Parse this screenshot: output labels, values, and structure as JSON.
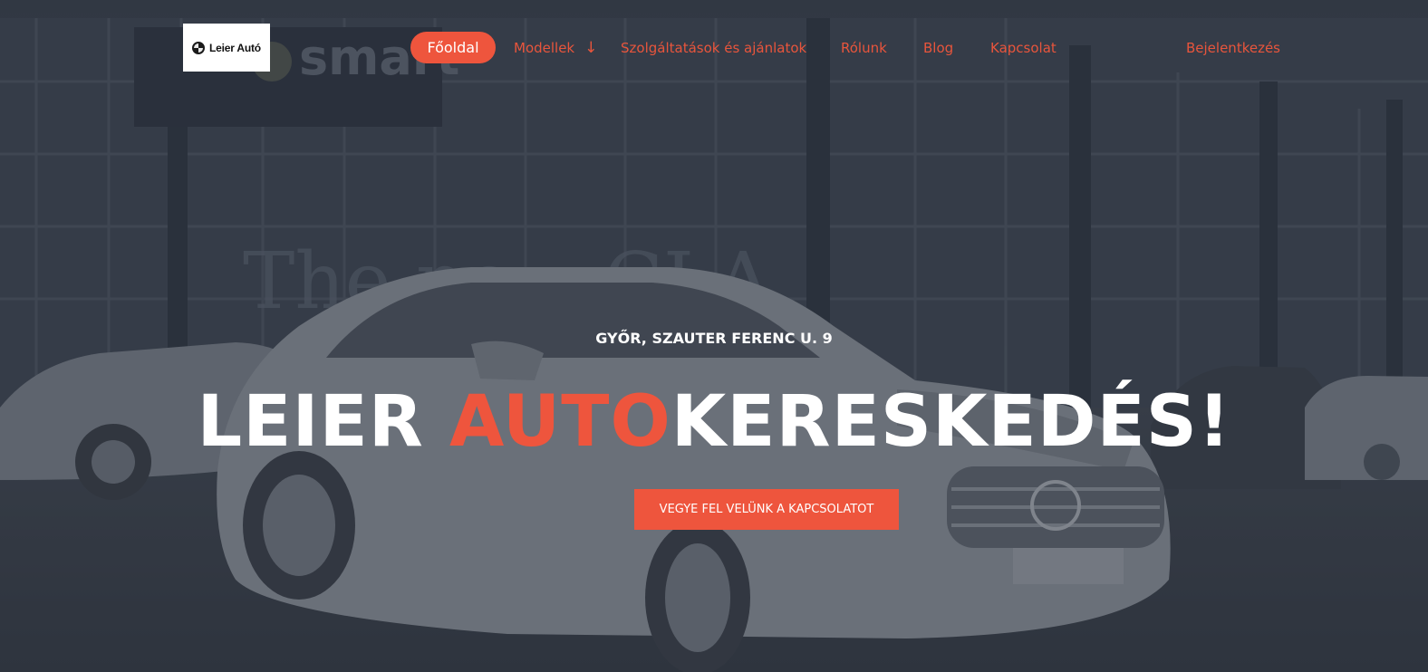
{
  "brand": {
    "logo_text": "Leier Autó"
  },
  "nav": {
    "home": "Főoldal",
    "models": "Modellek",
    "services": "Szolgáltatások és ajánlatok",
    "about": "Rólunk",
    "blog": "Blog",
    "contact": "Kapcsolat",
    "login": "Bejelentkezés"
  },
  "hero": {
    "address": "GYŐR, SZAUTER FERENC U. 9",
    "headline_part1": "LEIER ",
    "headline_accent": "AUTO",
    "headline_part2": "KERESKEDÉS!",
    "cta": "VEGYE FEL VELÜNK A KAPCSOLATOT",
    "background_sign_text": "smart",
    "background_glass_text": "The new CLA"
  },
  "colors": {
    "accent": "#ee553d",
    "nav_text": "#e8553c",
    "overlay": "#2f3641",
    "headline": "#ffffff"
  },
  "icons": {
    "models_dropdown": "arrow-down-icon",
    "logo": "car-brand-emblem-icon"
  }
}
